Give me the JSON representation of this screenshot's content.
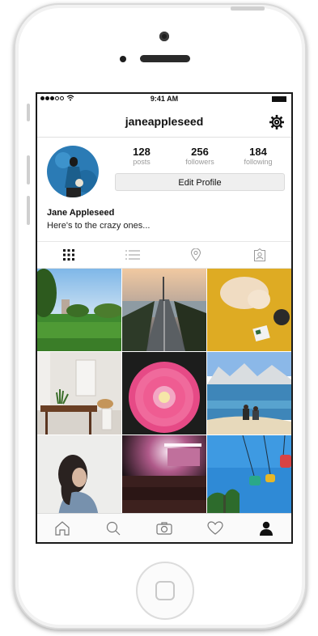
{
  "status_bar": {
    "time": "9:41 AM"
  },
  "header": {
    "username": "janeappleseed"
  },
  "profile": {
    "stats": [
      {
        "value": "128",
        "label": "posts"
      },
      {
        "value": "256",
        "label": "followers"
      },
      {
        "value": "184",
        "label": "following"
      }
    ],
    "edit_button_label": "Edit Profile",
    "full_name": "Jane Appleseed",
    "bio": "Here's to the crazy ones..."
  },
  "view_tabs": [
    {
      "icon": "grid-icon",
      "active": true
    },
    {
      "icon": "list-icon",
      "active": false
    },
    {
      "icon": "location-pin-icon",
      "active": false
    },
    {
      "icon": "tagged-person-icon",
      "active": false
    }
  ],
  "photos": [
    "park-with-trees-photo",
    "bay-bridge-traffic-photo",
    "cat-on-yellow-rug-photo",
    "dining-room-photo",
    "pink-flower-photo",
    "couple-at-lake-photo",
    "woman-portrait-photo",
    "concert-crowd-photo",
    "amusement-ride-photo"
  ],
  "tab_bar": [
    {
      "icon": "home-icon",
      "active": false
    },
    {
      "icon": "search-icon",
      "active": false
    },
    {
      "icon": "camera-icon",
      "active": false
    },
    {
      "icon": "heart-icon",
      "active": false
    },
    {
      "icon": "profile-icon",
      "active": true
    }
  ],
  "colors": {
    "text": "#111111",
    "muted": "#9a9a9a",
    "button_bg": "#efefef"
  }
}
